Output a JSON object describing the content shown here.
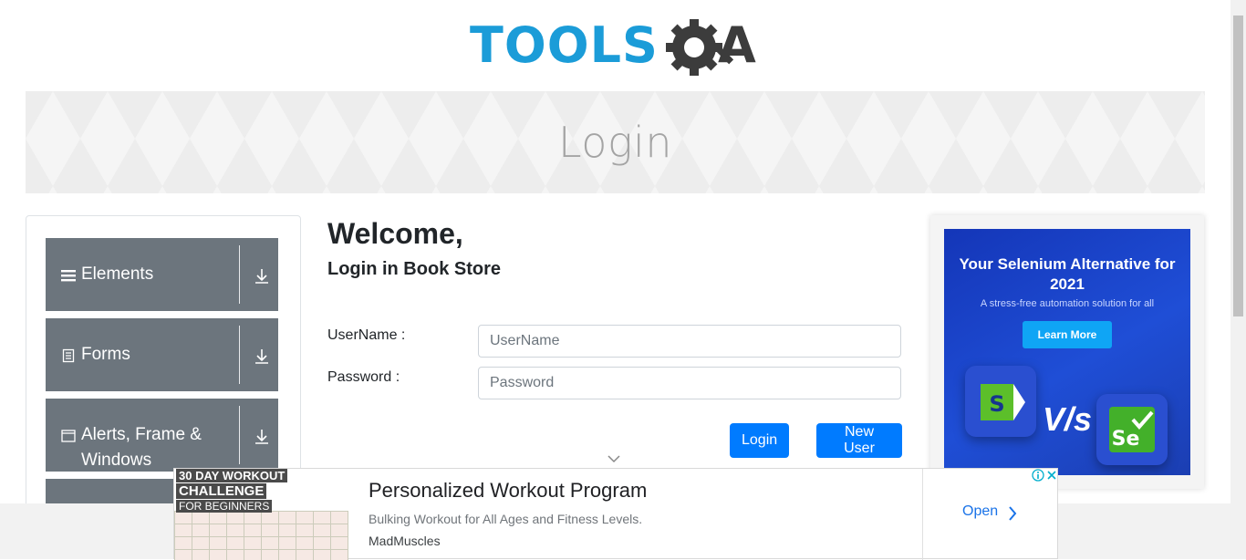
{
  "header": {
    "logo_part1": "TOOLS",
    "logo_part2": "QA"
  },
  "banner": {
    "title": "Login"
  },
  "sidebar": {
    "groups": [
      {
        "label": "Elements",
        "icon": "hamburger-icon"
      },
      {
        "label": "Forms",
        "icon": "document-icon"
      },
      {
        "label": "Alerts, Frame & Windows",
        "icon": "window-icon"
      },
      {
        "label": "",
        "icon": ""
      }
    ]
  },
  "login": {
    "heading": "Welcome,",
    "subheading": "Login in Book Store",
    "username_label": "UserName :",
    "username_placeholder": "UserName",
    "password_label": "Password :",
    "password_placeholder": "Password",
    "login_button": "Login",
    "new_user_button": "New User"
  },
  "side_ad": {
    "title": "Your Selenium Alternative for 2021",
    "subtitle": "A stress-free automation solution for all",
    "cta": "Learn More",
    "vs": "V/s",
    "brand_left": "S",
    "brand_right": "Se",
    "colors": {
      "bg": "#1f4ed6",
      "cta": "#0fa5f5"
    }
  },
  "bottom_ad": {
    "thumb_lines": [
      "30 DAY WORKOUT",
      "CHALLENGE",
      "FOR BEGINNERS"
    ],
    "headline": "Personalized Workout Program",
    "description": "Bulking Workout for All Ages and Fitness Levels.",
    "brand": "MadMuscles",
    "open": "Open"
  },
  "colors": {
    "accent": "#007bff",
    "sidebar": "#6c757d",
    "logo_blue": "#1b9cd8",
    "logo_dark": "#3c3c3c"
  }
}
